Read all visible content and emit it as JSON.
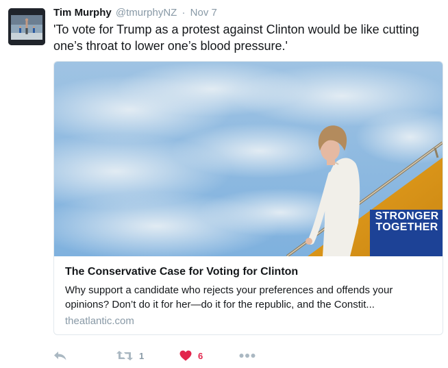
{
  "tweet": {
    "author_name": "Tim Murphy",
    "author_handle": "@tmurphyNZ",
    "separator": "·",
    "timestamp": "Nov 7",
    "text": "'To vote for Trump as a protest against Clinton would be like cutting one’s throat to lower one’s blood pressure.'"
  },
  "card": {
    "image_sign_text": "STRONGER TOGETHER",
    "title": "The Conservative Case for Voting for Clinton",
    "description": "Why support a candidate who rejects your preferences and offends your opinions? Don’t do it for her—do it for the republic, and the Constit...",
    "domain": "theatlantic.com"
  },
  "actions": {
    "reply_icon": "reply-icon",
    "retweet_icon": "retweet-icon",
    "retweet_count": "1",
    "like_icon": "heart-icon",
    "like_count": "6",
    "more_icon": "more-dots-icon",
    "like_color": "#e2264d",
    "muted_color": "#aab8c2"
  }
}
